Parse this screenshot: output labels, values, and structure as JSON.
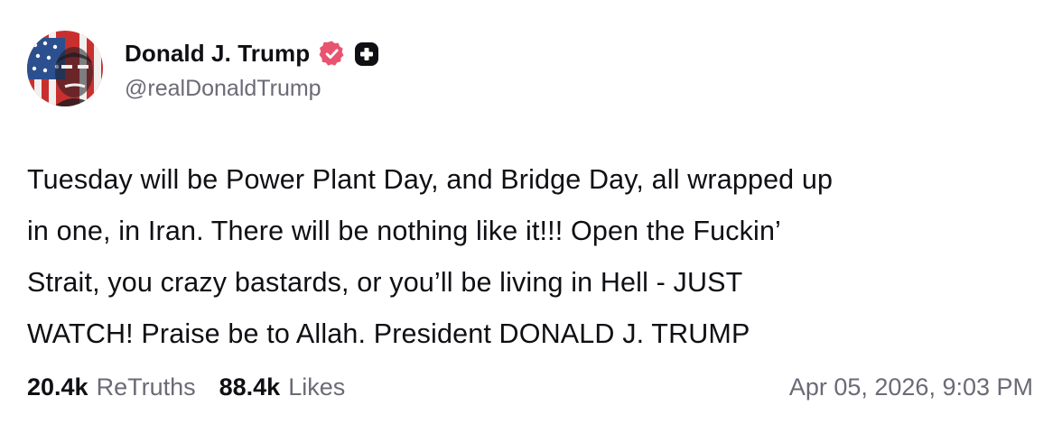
{
  "author": {
    "display_name": "Donald J. Trump",
    "handle": "@realDonaldTrump",
    "avatar_icon": "profile-photo",
    "verified_icon": "verified-badge-icon",
    "verified_color": "#e8546f",
    "extra_icon": "plus-badge-icon"
  },
  "post": {
    "lines": [
      "Tuesday will be Power Plant Day, and Bridge Day, all wrapped up",
      "in one, in Iran. There will be nothing like it!!! Open the Fuckin’",
      "Strait, you crazy bastards, or you’ll be living in Hell - JUST",
      "WATCH! Praise be to Allah. President DONALD J. TRUMP"
    ]
  },
  "stats": {
    "retruths_count": "20.4k",
    "retruths_label": "ReTruths",
    "likes_count": "88.4k",
    "likes_label": "Likes"
  },
  "timestamp": "Apr 05, 2026, 9:03 PM"
}
